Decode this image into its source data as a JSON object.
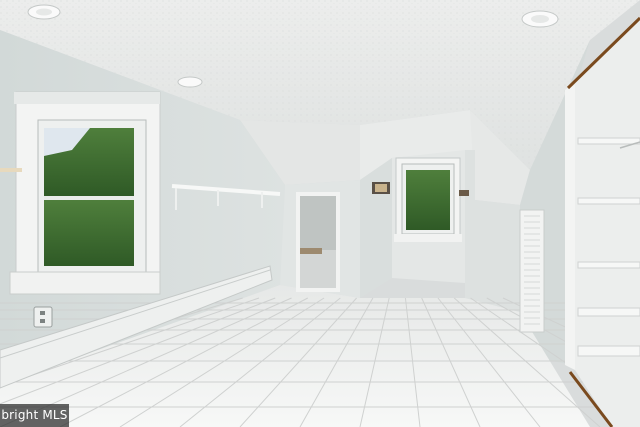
{
  "watermark": {
    "text": "bright MLS"
  },
  "colors": {
    "ceiling": "#eef0ef",
    "wall_left": "#d6dcdb",
    "wall_back": "#e3e6e5",
    "floor": "#f2f3f2",
    "grout": "#c9cbca",
    "window_foliage": "#3a6a2e",
    "trim": "#f4f5f4",
    "closet_door_frame": "#7a4a1e"
  },
  "icons": [
    "ceiling-light-icon",
    "wall-sconce-icon",
    "outlet-icon"
  ]
}
